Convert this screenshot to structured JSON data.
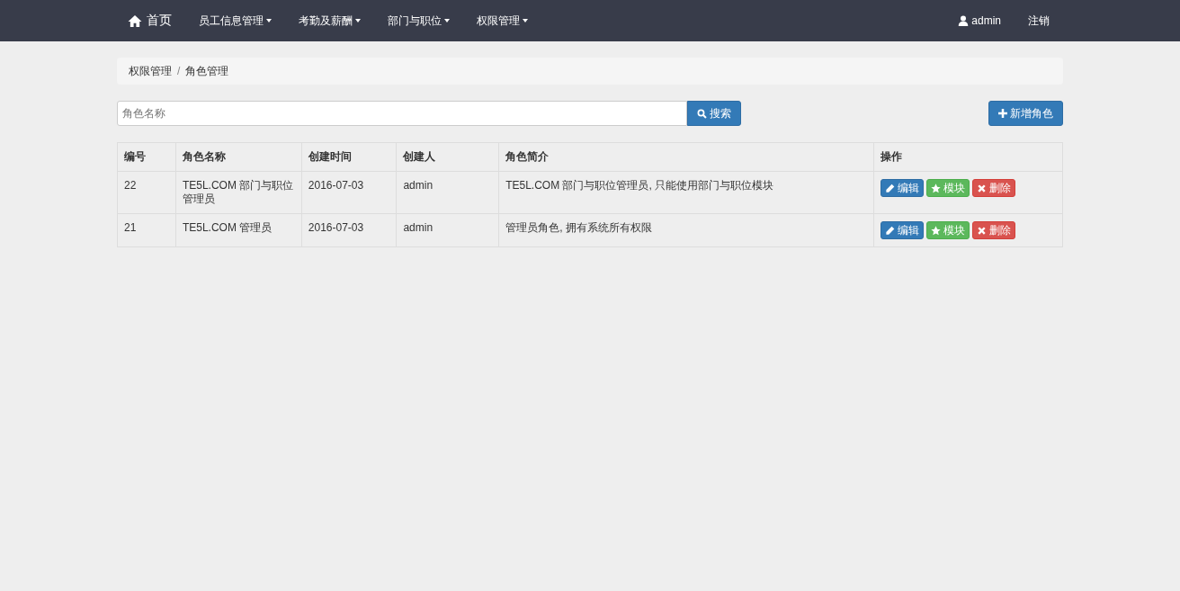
{
  "navbar": {
    "home": "首页",
    "menus": [
      {
        "label": "员工信息管理"
      },
      {
        "label": "考勤及薪酬"
      },
      {
        "label": "部门与职位"
      },
      {
        "label": "权限管理"
      }
    ],
    "user": "admin",
    "logout": "注销"
  },
  "breadcrumb": {
    "separator": "/",
    "items": [
      "权限管理",
      "角色管理"
    ]
  },
  "search": {
    "placeholder": "角色名称",
    "button": "搜索"
  },
  "add_button": "新增角色",
  "table": {
    "columns": [
      "编号",
      "角色名称",
      "创建时间",
      "创建人",
      "角色简介",
      "操作"
    ],
    "rows": [
      {
        "cells": [
          "22",
          "TE5L.COM 部门与职位管理员",
          "2016-07-03",
          "admin",
          "TE5L.COM 部门与职位管理员, 只能使用部门与职位模块"
        ],
        "actions": [
          {
            "kind": "edit",
            "label": "编辑"
          },
          {
            "kind": "module",
            "label": "模块"
          },
          {
            "kind": "delete",
            "label": "删除"
          }
        ]
      },
      {
        "cells": [
          "21",
          "TE5L.COM 管理员",
          "2016-07-03",
          "admin",
          "管理员角色, 拥有系统所有权限"
        ],
        "actions": [
          {
            "kind": "edit",
            "label": "编辑"
          },
          {
            "kind": "module",
            "label": "模块"
          },
          {
            "kind": "delete",
            "label": "删除"
          }
        ]
      }
    ]
  }
}
